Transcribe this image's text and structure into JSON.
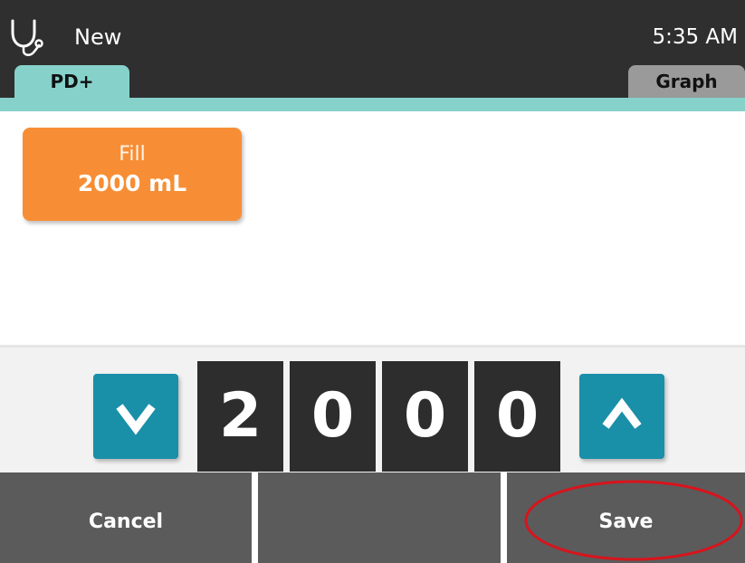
{
  "header": {
    "title": "New",
    "time": "5:35 AM"
  },
  "tabs": [
    {
      "label": "PD+"
    },
    {
      "label": "Graph"
    }
  ],
  "fill_card": {
    "label": "Fill",
    "value": "2000 mL"
  },
  "stepper": {
    "digits": [
      "2",
      "0",
      "0",
      "0"
    ]
  },
  "bottom_bar": {
    "cancel_label": "Cancel",
    "middle_label": "",
    "save_label": "Save"
  },
  "colors": {
    "header_bg": "#2f2f2f",
    "tab_accent": "#86d2cb",
    "fill_card": "#f78e35",
    "stepper_arrows": "#1a8fa8",
    "digit_bg": "#2d2d2d",
    "bottom_buttons": "#5b5b5c",
    "highlight_circle": "#d8141c"
  },
  "icons": {
    "app_icon": "stethoscope-icon",
    "decrement": "chevron-down-icon",
    "increment": "chevron-up-icon"
  }
}
